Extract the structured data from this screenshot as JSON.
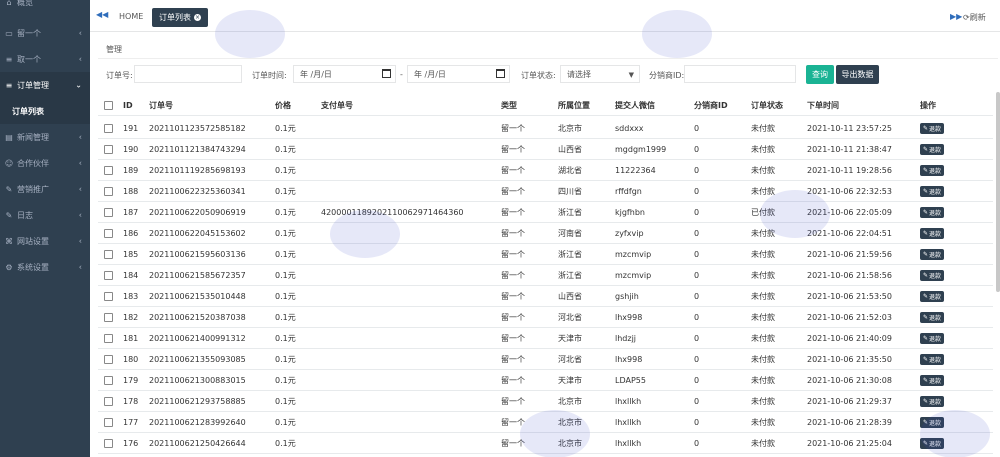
{
  "sidebar": {
    "items": [
      {
        "label": "概览",
        "icon": "home-icon",
        "has_arrow": false
      },
      {
        "label": "留一个",
        "icon": "desktop-icon",
        "has_arrow": true
      },
      {
        "label": "取一个",
        "icon": "list-icon",
        "has_arrow": true
      },
      {
        "label": "订单管理",
        "icon": "list-icon",
        "has_arrow": true,
        "open": true
      },
      {
        "label": "新闻管理",
        "icon": "newspaper-icon",
        "has_arrow": true
      },
      {
        "label": "合作伙伴",
        "icon": "users-icon",
        "has_arrow": true
      },
      {
        "label": "营销推广",
        "icon": "edit-icon",
        "has_arrow": true
      },
      {
        "label": "日志",
        "icon": "edit-icon",
        "has_arrow": true
      },
      {
        "label": "网站设置",
        "icon": "sitemap-icon",
        "has_arrow": true
      },
      {
        "label": "系统设置",
        "icon": "gear-icon",
        "has_arrow": true
      }
    ],
    "sub_item": "订单列表"
  },
  "topbar": {
    "home": "HOME",
    "active_tab": "订单列表",
    "refresh": "刷新"
  },
  "breadcrumb": "管理",
  "filters": {
    "order_no_label": "订单号:",
    "order_time_label": "订单时间:",
    "date_placeholder": "年 /月/日",
    "date_sep": "-",
    "status_label": "订单状态:",
    "status_value": "请选择",
    "distributor_label": "分销商ID:",
    "search_btn": "查询",
    "export_btn": "导出数据"
  },
  "table": {
    "headers": [
      "ID",
      "订单号",
      "价格",
      "支付单号",
      "类型",
      "所属位置",
      "提交人微信",
      "分销商ID",
      "订单状态",
      "下单时间",
      "操作"
    ],
    "refund_label": "退款",
    "rows": [
      {
        "id": "191",
        "order": "2021101123572585182",
        "price": "0.1元",
        "pay": "",
        "type": "留一个",
        "loc": "北京市",
        "wx": "sddxxx",
        "dist": "0",
        "status": "未付款",
        "time": "2021-10-11 23:57:25"
      },
      {
        "id": "190",
        "order": "2021101121384743294",
        "price": "0.1元",
        "pay": "",
        "type": "留一个",
        "loc": "山西省",
        "wx": "mgdgm1999",
        "dist": "0",
        "status": "未付款",
        "time": "2021-10-11 21:38:47"
      },
      {
        "id": "189",
        "order": "2021101119285698193",
        "price": "0.1元",
        "pay": "",
        "type": "留一个",
        "loc": "湖北省",
        "wx": "11222364",
        "dist": "0",
        "status": "未付款",
        "time": "2021-10-11 19:28:56"
      },
      {
        "id": "188",
        "order": "2021100622325360341",
        "price": "0.1元",
        "pay": "",
        "type": "留一个",
        "loc": "四川省",
        "wx": "rffdfgn",
        "dist": "0",
        "status": "未付款",
        "time": "2021-10-06 22:32:53"
      },
      {
        "id": "187",
        "order": "2021100622050906919",
        "price": "0.1元",
        "pay": "4200001189202110062971464360",
        "type": "留一个",
        "loc": "浙江省",
        "wx": "kjgfhbn",
        "dist": "0",
        "status": "已付款",
        "time": "2021-10-06 22:05:09"
      },
      {
        "id": "186",
        "order": "2021100622045153602",
        "price": "0.1元",
        "pay": "",
        "type": "留一个",
        "loc": "河南省",
        "wx": "zyfxvip",
        "dist": "0",
        "status": "未付款",
        "time": "2021-10-06 22:04:51"
      },
      {
        "id": "185",
        "order": "2021100621595603136",
        "price": "0.1元",
        "pay": "",
        "type": "留一个",
        "loc": "浙江省",
        "wx": "mzcmvip",
        "dist": "0",
        "status": "未付款",
        "time": "2021-10-06 21:59:56"
      },
      {
        "id": "184",
        "order": "2021100621585672357",
        "price": "0.1元",
        "pay": "",
        "type": "留一个",
        "loc": "浙江省",
        "wx": "mzcmvip",
        "dist": "0",
        "status": "未付款",
        "time": "2021-10-06 21:58:56"
      },
      {
        "id": "183",
        "order": "2021100621535010448",
        "price": "0.1元",
        "pay": "",
        "type": "留一个",
        "loc": "山西省",
        "wx": "gshjih",
        "dist": "0",
        "status": "未付款",
        "time": "2021-10-06 21:53:50"
      },
      {
        "id": "182",
        "order": "2021100621520387038",
        "price": "0.1元",
        "pay": "",
        "type": "留一个",
        "loc": "河北省",
        "wx": "lhx998",
        "dist": "0",
        "status": "未付款",
        "time": "2021-10-06 21:52:03"
      },
      {
        "id": "181",
        "order": "2021100621400991312",
        "price": "0.1元",
        "pay": "",
        "type": "留一个",
        "loc": "天津市",
        "wx": "lhdzjj",
        "dist": "0",
        "status": "未付款",
        "time": "2021-10-06 21:40:09"
      },
      {
        "id": "180",
        "order": "2021100621355093085",
        "price": "0.1元",
        "pay": "",
        "type": "留一个",
        "loc": "河北省",
        "wx": "lhx998",
        "dist": "0",
        "status": "未付款",
        "time": "2021-10-06 21:35:50"
      },
      {
        "id": "179",
        "order": "2021100621300883015",
        "price": "0.1元",
        "pay": "",
        "type": "留一个",
        "loc": "天津市",
        "wx": "LDAP55",
        "dist": "0",
        "status": "未付款",
        "time": "2021-10-06 21:30:08"
      },
      {
        "id": "178",
        "order": "2021100621293758885",
        "price": "0.1元",
        "pay": "",
        "type": "留一个",
        "loc": "北京市",
        "wx": "lhxllkh",
        "dist": "0",
        "status": "未付款",
        "time": "2021-10-06 21:29:37"
      },
      {
        "id": "177",
        "order": "2021100621283992640",
        "price": "0.1元",
        "pay": "",
        "type": "留一个",
        "loc": "北京市",
        "wx": "lhxllkh",
        "dist": "0",
        "status": "未付款",
        "time": "2021-10-06 21:28:39"
      },
      {
        "id": "176",
        "order": "2021100621250426644",
        "price": "0.1元",
        "pay": "",
        "type": "留一个",
        "loc": "北京市",
        "wx": "lhxllkh",
        "dist": "0",
        "status": "未付款",
        "time": "2021-10-06 21:25:04"
      }
    ]
  }
}
